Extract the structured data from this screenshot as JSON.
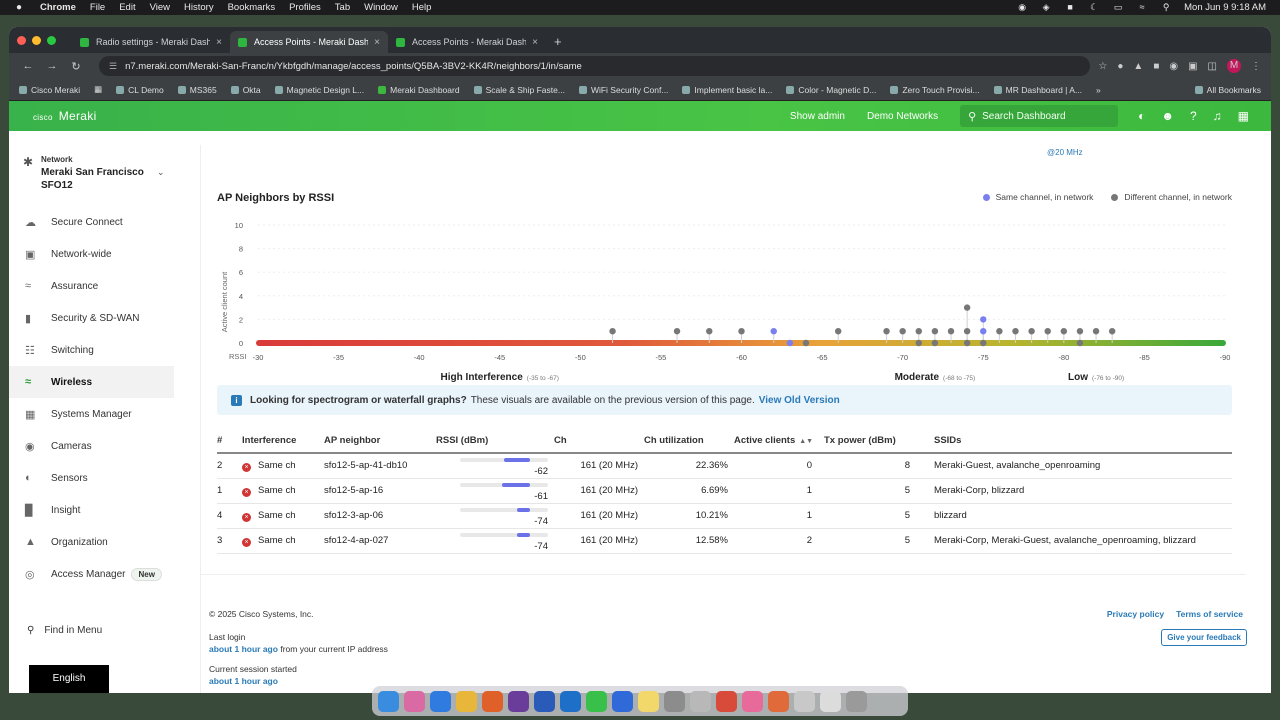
{
  "menubar": {
    "app": "Chrome",
    "items": [
      "File",
      "Edit",
      "View",
      "History",
      "Bookmarks",
      "Profiles",
      "Tab",
      "Window",
      "Help"
    ],
    "clock": "Mon Jun 9  9:18 AM"
  },
  "tabs": [
    {
      "label": "Radio settings - Meraki Dash"
    },
    {
      "label": "Access Points - Meraki Dash"
    },
    {
      "label": "Access Points - Meraki Dash"
    }
  ],
  "address": {
    "url": "n7.meraki.com/Meraki-San-Franc/n/Ykbfgdh/manage/access_points/Q5BA-3BV2-KK4R/neighbors/1/in/same"
  },
  "bookmarks": [
    "Cisco Meraki",
    "CL Demo",
    "MS365",
    "Okta",
    "Magnetic Design L...",
    "Meraki Dashboard",
    "Scale & Ship Faste...",
    "WiFi Security Conf...",
    "Implement basic la...",
    "Color - Magnetic D...",
    "Zero Touch Provisi...",
    "MR Dashboard | A..."
  ],
  "bookmarks_all": "All Bookmarks",
  "header": {
    "logo_top": "cisco",
    "logo": "Meraki",
    "show_admin": "Show admin",
    "demo_networks": "Demo Networks",
    "search_placeholder": "Search Dashboard"
  },
  "sidebar": {
    "network_label": "Network",
    "network_name": "Meraki San Francisco SFO12",
    "items": [
      {
        "label": "Secure Connect",
        "icon": "cloud-icon"
      },
      {
        "label": "Network-wide",
        "icon": "network-icon"
      },
      {
        "label": "Assurance",
        "icon": "chart-icon"
      },
      {
        "label": "Security & SD-WAN",
        "icon": "shield-icon"
      },
      {
        "label": "Switching",
        "icon": "switch-icon"
      },
      {
        "label": "Wireless",
        "icon": "wifi-icon"
      },
      {
        "label": "Systems Manager",
        "icon": "grid-icon"
      },
      {
        "label": "Cameras",
        "icon": "camera-icon"
      },
      {
        "label": "Sensors",
        "icon": "sensor-icon"
      },
      {
        "label": "Insight",
        "icon": "bar-icon"
      },
      {
        "label": "Organization",
        "icon": "org-icon"
      },
      {
        "label": "Access Manager",
        "icon": "fingerprint-icon",
        "badge": "New"
      }
    ],
    "find": "Find in Menu",
    "language": "English"
  },
  "page": {
    "mhz_note": "@20 MHz",
    "chart_title": "AP Neighbors by RSSI",
    "legend": [
      "Same channel, in network",
      "Different channel, in network"
    ],
    "banner_bold": "Looking for spectrogram or waterfall graphs?",
    "banner_text": "These visuals are available on the previous version of this page.",
    "banner_link": "View Old Version"
  },
  "chart_data": {
    "type": "scatter",
    "ylabel": "Active client count",
    "xlabel": "RSSI",
    "yticks": [
      0,
      2,
      4,
      6,
      8,
      10
    ],
    "xticks": [
      -30,
      -35,
      -40,
      -45,
      -50,
      -55,
      -60,
      -65,
      -70,
      -75,
      -80,
      -85,
      -90
    ],
    "xlim": [
      -30,
      -90
    ],
    "ylim": [
      0,
      10
    ],
    "zones": [
      {
        "name": "High Interference",
        "range": "(-35 to -67)",
        "at": -45
      },
      {
        "name": "Moderate",
        "range": "(-68 to -75)",
        "at": -72
      },
      {
        "name": "Low",
        "range": "(-76 to -90)",
        "at": -82
      }
    ],
    "colors": {
      "same": "#7a7ff0",
      "different": "#777777"
    },
    "points": [
      {
        "x": -52,
        "y": 1,
        "s": "different"
      },
      {
        "x": -56,
        "y": 1,
        "s": "different"
      },
      {
        "x": -58,
        "y": 1,
        "s": "different"
      },
      {
        "x": -60,
        "y": 1,
        "s": "different"
      },
      {
        "x": -62,
        "y": 1,
        "s": "same"
      },
      {
        "x": -63,
        "y": 0,
        "s": "same"
      },
      {
        "x": -64,
        "y": 0,
        "s": "different"
      },
      {
        "x": -66,
        "y": 1,
        "s": "different"
      },
      {
        "x": -69,
        "y": 1,
        "s": "different"
      },
      {
        "x": -70,
        "y": 1,
        "s": "different"
      },
      {
        "x": -71,
        "y": 1,
        "s": "different"
      },
      {
        "x": -71,
        "y": 0,
        "s": "different"
      },
      {
        "x": -72,
        "y": 1,
        "s": "different"
      },
      {
        "x": -72,
        "y": 0,
        "s": "different"
      },
      {
        "x": -73,
        "y": 1,
        "s": "different"
      },
      {
        "x": -74,
        "y": 1,
        "s": "different"
      },
      {
        "x": -74,
        "y": 3,
        "s": "different"
      },
      {
        "x": -74,
        "y": 0,
        "s": "different"
      },
      {
        "x": -75,
        "y": 2,
        "s": "same"
      },
      {
        "x": -75,
        "y": 1,
        "s": "same"
      },
      {
        "x": -75,
        "y": 0,
        "s": "different"
      },
      {
        "x": -76,
        "y": 1,
        "s": "different"
      },
      {
        "x": -77,
        "y": 1,
        "s": "different"
      },
      {
        "x": -78,
        "y": 1,
        "s": "different"
      },
      {
        "x": -79,
        "y": 1,
        "s": "different"
      },
      {
        "x": -80,
        "y": 1,
        "s": "different"
      },
      {
        "x": -81,
        "y": 1,
        "s": "different"
      },
      {
        "x": -81,
        "y": 0,
        "s": "different"
      },
      {
        "x": -82,
        "y": 1,
        "s": "different"
      },
      {
        "x": -83,
        "y": 1,
        "s": "different"
      }
    ]
  },
  "table": {
    "headers": [
      "#",
      "Interference",
      "AP neighbor",
      "RSSI (dBm)",
      "Ch",
      "Ch utilization",
      "Active clients",
      "Tx power (dBm)",
      "SSIDs"
    ],
    "rows": [
      {
        "num": "2",
        "interference": "Same ch",
        "ap": "sfo12-5-ap-41-db10",
        "rssi": "-62",
        "rssi_level": 0.3,
        "ch": "161 (20 MHz)",
        "util": "22.36%",
        "clients": "0",
        "tx": "8",
        "ssids": "Meraki-Guest, avalanche_openroaming"
      },
      {
        "num": "1",
        "interference": "Same ch",
        "ap": "sfo12-5-ap-16",
        "rssi": "-61",
        "rssi_level": 0.32,
        "ch": "161 (20 MHz)",
        "util": "6.69%",
        "clients": "1",
        "tx": "5",
        "ssids": "Meraki-Corp, blizzard"
      },
      {
        "num": "4",
        "interference": "Same ch",
        "ap": "sfo12-3-ap-06",
        "rssi": "-74",
        "rssi_level": 0.15,
        "ch": "161 (20 MHz)",
        "util": "10.21%",
        "clients": "1",
        "tx": "5",
        "ssids": "blizzard"
      },
      {
        "num": "3",
        "interference": "Same ch",
        "ap": "sfo12-4-ap-027",
        "rssi": "-74",
        "rssi_level": 0.15,
        "ch": "161 (20 MHz)",
        "util": "12.58%",
        "clients": "2",
        "tx": "5",
        "ssids": "Meraki-Corp, Meraki-Guest, avalanche_openroaming, blizzard"
      }
    ]
  },
  "footer": {
    "copyright": "© 2025 Cisco Systems, Inc.",
    "privacy": "Privacy policy",
    "terms": "Terms of service",
    "feedback": "Give your feedback",
    "last_login_label": "Last login",
    "last_login_when": "about 1 hour ago",
    "last_login_from": "from your current IP address",
    "session_label": "Current session started",
    "session_when": "about 1 hour ago"
  }
}
